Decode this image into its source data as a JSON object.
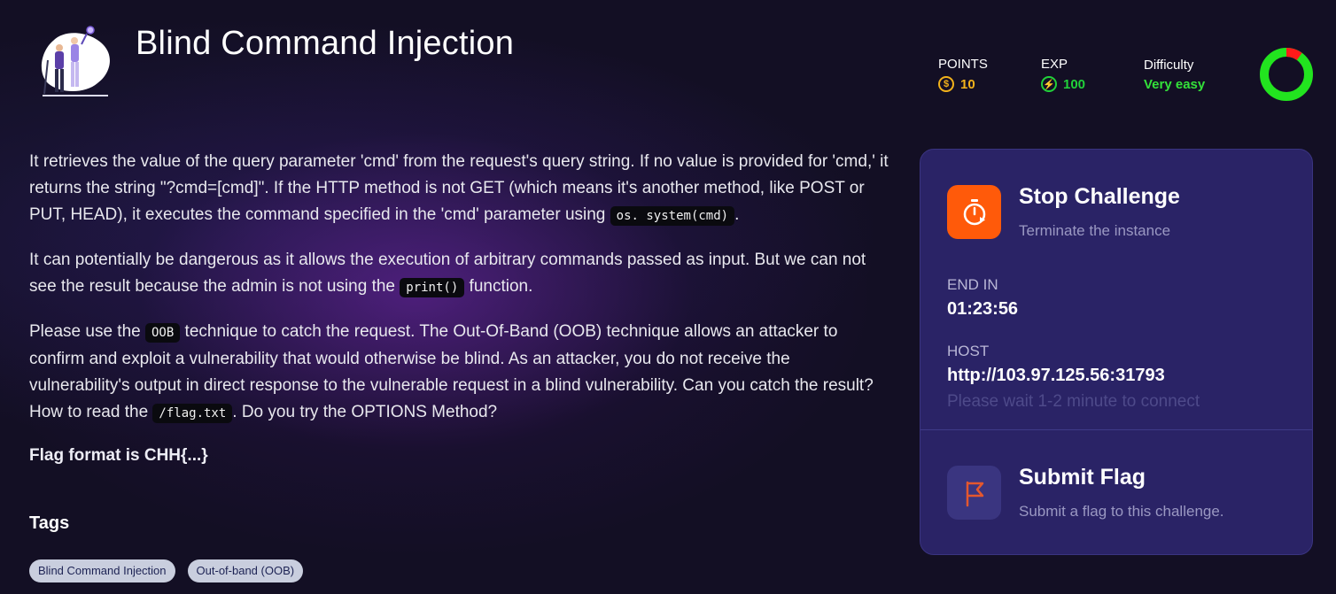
{
  "challenge": {
    "title": "Blind Command Injection"
  },
  "stats": {
    "points": {
      "label": "POINTS",
      "value": "10",
      "icon": "coin-icon"
    },
    "exp": {
      "label": "EXP",
      "value": "100",
      "icon": "bolt-icon"
    },
    "difficulty": {
      "label": "Difficulty",
      "value": "Very easy",
      "icon": "difficulty-donut"
    }
  },
  "difficulty_gauge": {
    "level": 0.1,
    "colors": {
      "easy": "#22e41f",
      "hard": "#ff1a1a"
    }
  },
  "description": {
    "p1_a": "It retrieves the value of the query parameter 'cmd' from the request's query string. If no value is provided for 'cmd,' it returns the string \"?cmd=[cmd]\". If the HTTP method is not GET (which means it's another method, like POST or PUT, HEAD), it executes the command specified in the 'cmd' parameter using ",
    "p1_code": "os. system(cmd)",
    "p1_b": ".",
    "p2_a": "It can potentially be dangerous as it allows the execution of arbitrary commands passed as input. But we can not see the result because the admin is not using the ",
    "p2_code": "print()",
    "p2_b": " function.",
    "p3_a": "Please use the ",
    "p3_code1": "OOB",
    "p3_b": " technique to catch the request. The Out-Of-Band (OOB) technique allows an attacker to confirm and exploit a vulnerability that would otherwise be blind. As an attacker, you do not receive the vulnerability's output in direct response to the vulnerable request in a blind vulnerability. Can you catch the result? How to read the ",
    "p3_code2": "/flag.txt",
    "p3_c": ". Do you try the OPTIONS Method?",
    "flag_format": "Flag format is CHH{...}"
  },
  "tags": {
    "title": "Tags",
    "items": [
      "Blind Command Injection",
      "Out-of-band (OOB)"
    ]
  },
  "panel": {
    "stop": {
      "title": "Stop Challenge",
      "subtitle": "Terminate the instance",
      "icon": "stopwatch-icon"
    },
    "end_in": {
      "label": "END IN",
      "value": "01:23:56"
    },
    "host": {
      "label": "HOST",
      "value": "http://103.97.125.56:31793"
    },
    "wait_note": "Please wait 1-2 minute to connect",
    "submit": {
      "title": "Submit Flag",
      "subtitle": "Submit a flag to this challenge.",
      "icon": "flag-icon"
    }
  },
  "colors": {
    "background": "#130f24",
    "panel": "#2a2366",
    "stop_accent": "#ff5a0a",
    "points": "#f2b21b",
    "exp": "#21d13a"
  }
}
